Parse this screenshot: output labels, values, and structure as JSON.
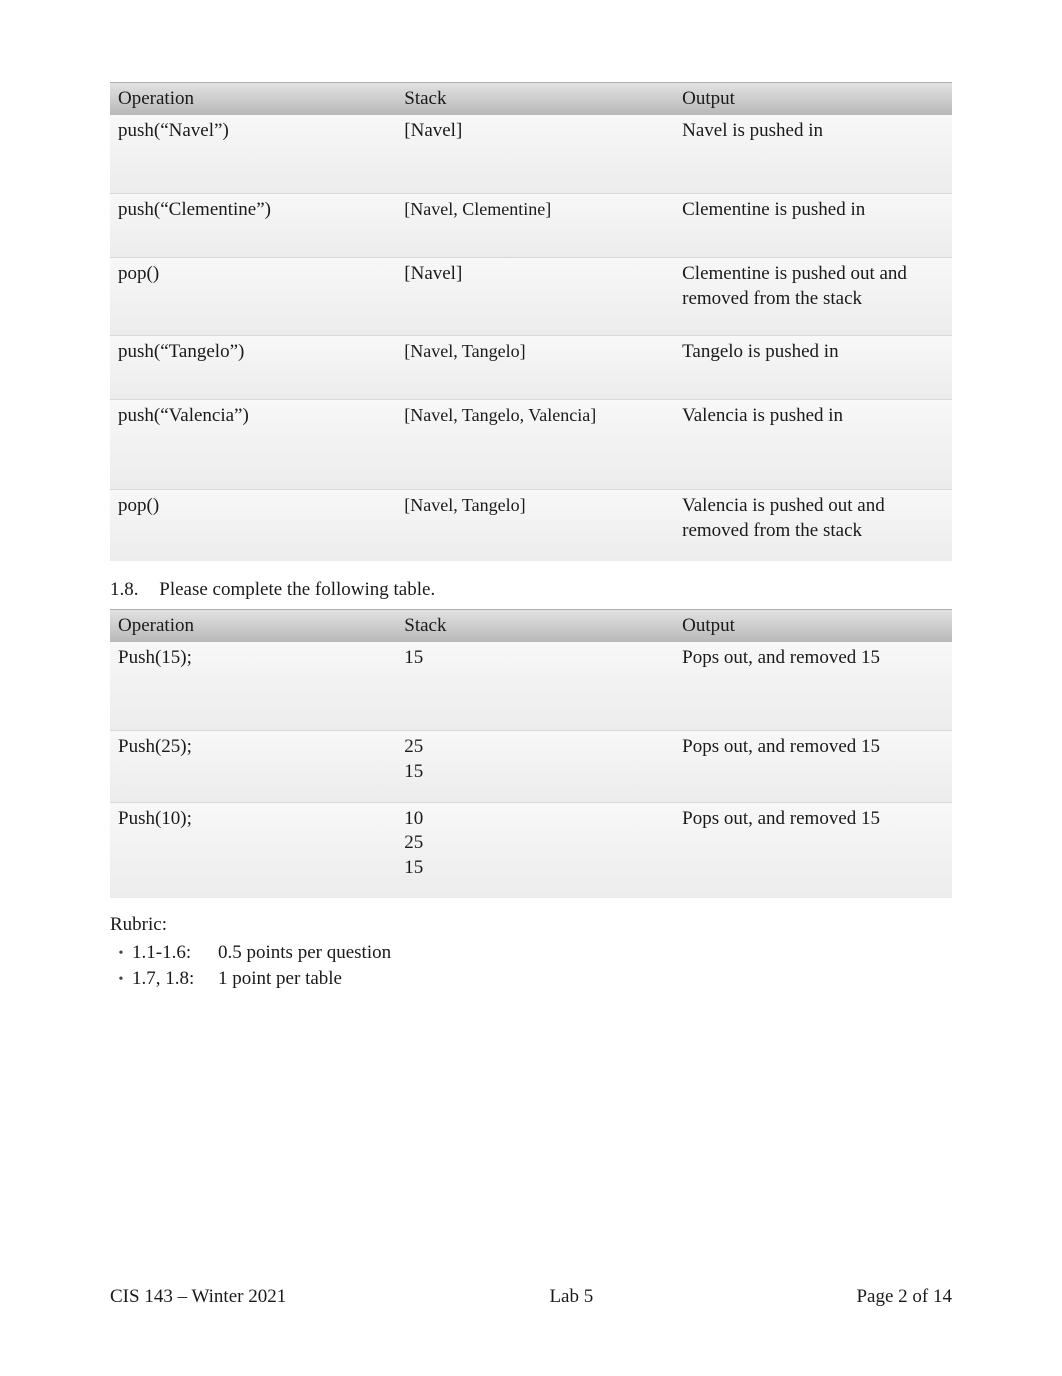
{
  "table1": {
    "headers": {
      "op": "Operation",
      "stack": "Stack",
      "out": "Output"
    },
    "rows": [
      {
        "op": "push(“Navel”)",
        "stack": "[Navel]",
        "out": "Navel is pushed in"
      },
      {
        "op": "push(“Clementine”)",
        "stack": "[Navel, Clementine]",
        "out": "Clementine is pushed in"
      },
      {
        "op": "pop()",
        "stack": "[Navel]",
        "out": "Clementine is pushed out and removed from the stack"
      },
      {
        "op": "push(“Tangelo”)",
        "stack": "[Navel, Tangelo]",
        "out": "Tangelo is pushed in"
      },
      {
        "op": "push(“Valencia”)",
        "stack": "[Navel, Tangelo, Valencia]",
        "out": "Valencia is pushed in"
      },
      {
        "op": "pop()",
        "stack": "[Navel, Tangelo]",
        "out": "Valencia is pushed out and removed from the stack"
      }
    ]
  },
  "section_1_8": {
    "num": "1.8.",
    "text": "Please complete the following table."
  },
  "table2": {
    "headers": {
      "op": "Operation",
      "stack": "Stack",
      "out": "Output"
    },
    "rows": [
      {
        "op": "Push(15);",
        "stack": "15",
        "out": "Pops out, and removed 15"
      },
      {
        "op": "Push(25);",
        "stack": "25\n15",
        "out": "Pops out, and removed 15"
      },
      {
        "op": "Push(10);",
        "stack": "10\n25\n15",
        "out": "Pops out, and removed 15"
      }
    ]
  },
  "rubric": {
    "title": "Rubric:",
    "items": [
      {
        "label": "1.1-1.6:",
        "desc": "0.5 points per question"
      },
      {
        "label": "1.7, 1.8:",
        "desc": "1 point per table"
      }
    ]
  },
  "footer": {
    "left": "CIS 143 – Winter 2021",
    "center": "Lab 5",
    "right": "Page 2 of 14"
  },
  "chart_data": [
    {
      "type": "table",
      "title": "Stack operations (Table 1)",
      "columns": [
        "Operation",
        "Stack",
        "Output"
      ],
      "rows": [
        [
          "push(\"Navel\")",
          "[Navel]",
          "Navel is pushed in"
        ],
        [
          "push(\"Clementine\")",
          "[Navel, Clementine]",
          "Clementine is pushed in"
        ],
        [
          "pop()",
          "[Navel]",
          "Clementine is pushed out and removed from the stack"
        ],
        [
          "push(\"Tangelo\")",
          "[Navel, Tangelo]",
          "Tangelo is pushed in"
        ],
        [
          "push(\"Valencia\")",
          "[Navel, Tangelo, Valencia]",
          "Valencia is pushed in"
        ],
        [
          "pop()",
          "[Navel, Tangelo]",
          "Valencia is pushed out and removed from the stack"
        ]
      ]
    },
    {
      "type": "table",
      "title": "Stack operations (Table 2, Section 1.8)",
      "columns": [
        "Operation",
        "Stack",
        "Output"
      ],
      "rows": [
        [
          "Push(15);",
          "15",
          "Pops out, and removed 15"
        ],
        [
          "Push(25);",
          "25\n15",
          "Pops out, and removed 15"
        ],
        [
          "Push(10);",
          "10\n25\n15",
          "Pops out, and removed 15"
        ]
      ]
    }
  ]
}
